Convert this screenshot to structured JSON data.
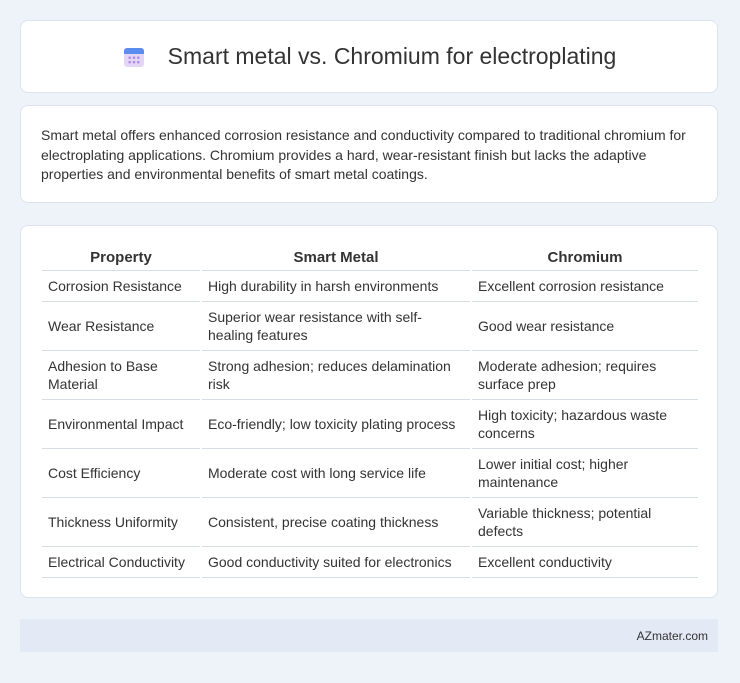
{
  "header": {
    "title": "Smart metal vs. Chromium for electroplating",
    "icon": "calendar-icon"
  },
  "intro": {
    "text": "Smart metal offers enhanced corrosion resistance and conductivity compared to traditional chromium for electroplating applications. Chromium provides a hard, wear-resistant finish but lacks the adaptive properties and environmental benefits of smart metal coatings."
  },
  "table": {
    "headers": [
      "Property",
      "Smart Metal",
      "Chromium"
    ],
    "rows": [
      [
        "Corrosion Resistance",
        "High durability in harsh environments",
        "Excellent corrosion resistance"
      ],
      [
        "Wear Resistance",
        "Superior wear resistance with self-healing features",
        "Good wear resistance"
      ],
      [
        "Adhesion to Base Material",
        "Strong adhesion; reduces delamination risk",
        "Moderate adhesion; requires surface prep"
      ],
      [
        "Environmental Impact",
        "Eco-friendly; low toxicity plating process",
        "High toxicity; hazardous waste concerns"
      ],
      [
        "Cost Efficiency",
        "Moderate cost with long service life",
        "Lower initial cost; higher maintenance"
      ],
      [
        "Thickness Uniformity",
        "Consistent, precise coating thickness",
        "Variable thickness; potential defects"
      ],
      [
        "Electrical Conductivity",
        "Good conductivity suited for electronics",
        "Excellent conductivity"
      ]
    ]
  },
  "footer": {
    "brand": "AZmater.com"
  },
  "colors": {
    "background": "#eef2f9",
    "card": "#ffffff",
    "footer_bg": "#e3e9f5",
    "icon_top": "#5b8def",
    "icon_body": "#d9c8f5"
  }
}
